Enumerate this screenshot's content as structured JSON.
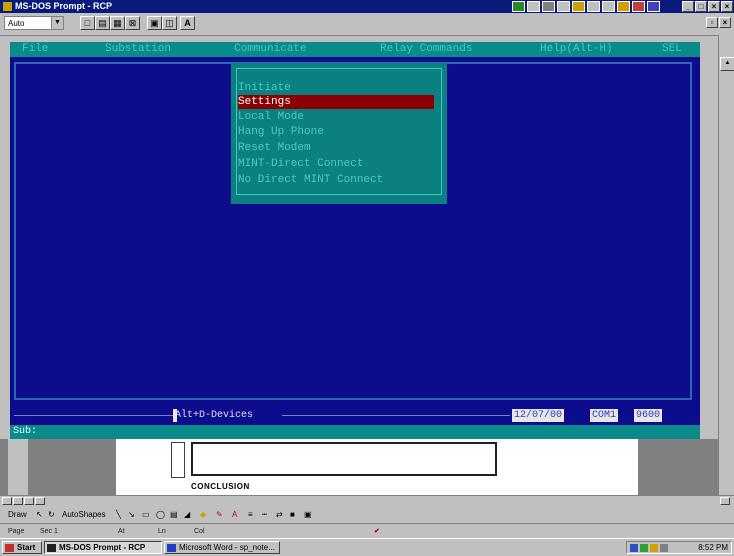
{
  "window": {
    "title": "MS-DOS Prompt - RCP"
  },
  "toolbar": {
    "font_select": "Auto",
    "font_button": "A"
  },
  "console": {
    "menubar": [
      {
        "label": "File"
      },
      {
        "label": "Substation"
      },
      {
        "label": "Communicate"
      },
      {
        "label": "Relay Commands"
      },
      {
        "label": "Help(Alt-H)"
      },
      {
        "label": "SEL"
      }
    ],
    "dropdown": [
      {
        "label": "Initiate"
      },
      {
        "label": "Settings"
      },
      {
        "label": "Local Mode"
      },
      {
        "label": "Hang Up Phone"
      },
      {
        "label": "Reset Modem"
      },
      {
        "label": "MINT-Direct Connect"
      },
      {
        "label": "No Direct MINT Connect"
      }
    ],
    "selected_item": "Settings",
    "status": {
      "devices_hint": "Alt+D-Devices",
      "date": "12/07/00",
      "port": "COM1",
      "baud": "9600"
    },
    "sub_label": "Sub:"
  },
  "document": {
    "heading": "CONCLUSION"
  },
  "drawbar": {
    "draw": "Draw",
    "autoshapes": "AutoShapes"
  },
  "wordstatus": {
    "page": "Page",
    "sec": "Sec 1",
    "at": "At",
    "ln": "Ln",
    "col": "Col"
  },
  "taskbar": {
    "start": "Start",
    "tasks": [
      {
        "label": "MS-DOS Prompt - RCP"
      },
      {
        "label": "Microsoft Word - sp_note..."
      }
    ],
    "clock": "8:52 PM"
  },
  "colors": {
    "console_bg": "#0c0c8c",
    "menu_bg": "#0a8a8a",
    "highlight": "#8a0000",
    "title_bar": "#0a1a7a"
  }
}
